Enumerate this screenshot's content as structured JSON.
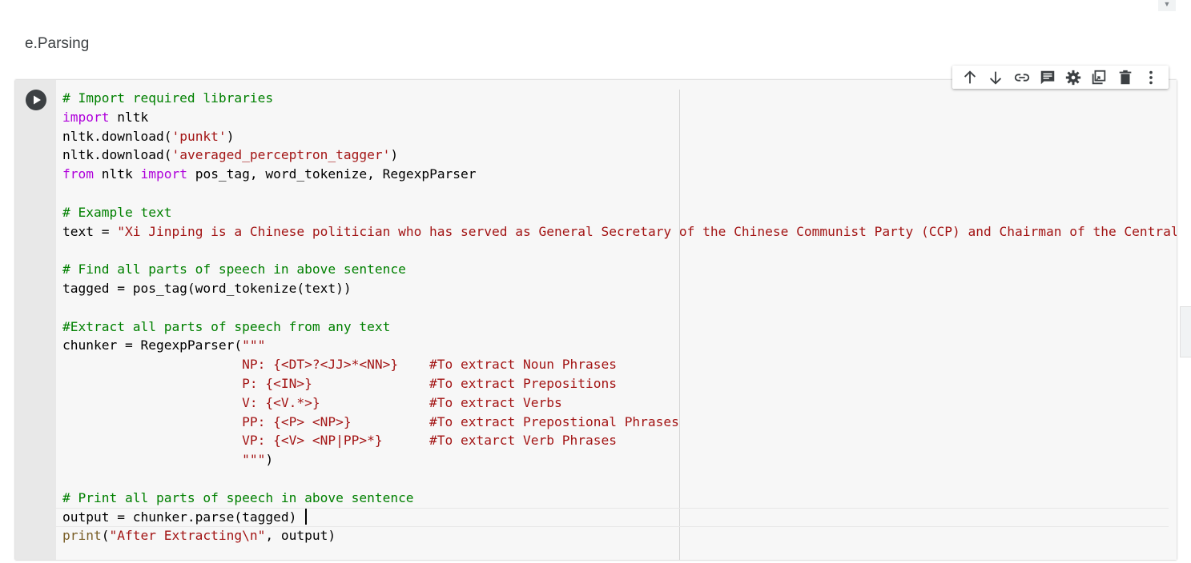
{
  "section": {
    "title": "e.Parsing"
  },
  "cell": {
    "run_icon": "play-circle-icon",
    "code_lines": [
      [
        {
          "t": "com",
          "v": "# Import required libraries"
        }
      ],
      [
        {
          "t": "kw",
          "v": "import"
        },
        {
          "t": "",
          "v": " nltk"
        }
      ],
      [
        {
          "t": "",
          "v": "nltk.download("
        },
        {
          "t": "str",
          "v": "'punkt'"
        },
        {
          "t": "",
          "v": ")"
        }
      ],
      [
        {
          "t": "",
          "v": "nltk.download("
        },
        {
          "t": "str",
          "v": "'averaged_perceptron_tagger'"
        },
        {
          "t": "",
          "v": ")"
        }
      ],
      [
        {
          "t": "kw",
          "v": "from"
        },
        {
          "t": "",
          "v": " nltk "
        },
        {
          "t": "kw",
          "v": "import"
        },
        {
          "t": "",
          "v": " pos_tag, word_tokenize, RegexpParser"
        }
      ],
      [],
      [
        {
          "t": "com",
          "v": "# Example text"
        }
      ],
      [
        {
          "t": "",
          "v": "text = "
        },
        {
          "t": "str",
          "v": "\"Xi Jinping is a Chinese politician who has served as General Secretary of the Chinese Communist Party (CCP) and Chairman of the Central"
        }
      ],
      [],
      [
        {
          "t": "com",
          "v": "# Find all parts of speech in above sentence"
        }
      ],
      [
        {
          "t": "",
          "v": "tagged = pos_tag(word_tokenize(text))"
        }
      ],
      [],
      [
        {
          "t": "com",
          "v": "#Extract all parts of speech from any text"
        }
      ],
      [
        {
          "t": "",
          "v": "chunker = RegexpParser("
        },
        {
          "t": "str",
          "v": "\"\"\""
        }
      ],
      [
        {
          "t": "str",
          "v": "                       NP: {<DT>?<JJ>*<NN>}    #To extract Noun Phrases"
        }
      ],
      [
        {
          "t": "str",
          "v": "                       P: {<IN>}               #To extract Prepositions"
        }
      ],
      [
        {
          "t": "str",
          "v": "                       V: {<V.*>}              #To extract Verbs"
        }
      ],
      [
        {
          "t": "str",
          "v": "                       PP: {<P> <NP>}          #To extract Prepostional Phrases"
        }
      ],
      [
        {
          "t": "str",
          "v": "                       VP: {<V> <NP|PP>*}      #To extarct Verb Phrases"
        }
      ],
      [
        {
          "t": "str",
          "v": "                       \"\"\""
        },
        {
          "t": "",
          "v": ")"
        }
      ],
      [],
      [
        {
          "t": "com",
          "v": "# Print all parts of speech in above sentence"
        }
      ],
      [
        {
          "t": "",
          "v": "output = chunker.parse(tagged) "
        },
        {
          "t": "cursor",
          "v": ""
        }
      ],
      [
        {
          "t": "fn",
          "v": "print"
        },
        {
          "t": "",
          "v": "("
        },
        {
          "t": "str",
          "v": "\"After Extracting\\n\""
        },
        {
          "t": "",
          "v": ", output)"
        }
      ]
    ]
  },
  "toolbar": {
    "buttons": [
      {
        "name": "move-cell-up-button",
        "icon": "arrow-up-icon"
      },
      {
        "name": "move-cell-down-button",
        "icon": "arrow-down-icon"
      },
      {
        "name": "link-to-cell-button",
        "icon": "link-icon"
      },
      {
        "name": "add-comment-button",
        "icon": "comment-icon"
      },
      {
        "name": "cell-settings-button",
        "icon": "gear-icon"
      },
      {
        "name": "mirror-cell-button",
        "icon": "mirror-tab-icon"
      },
      {
        "name": "delete-cell-button",
        "icon": "trash-icon"
      },
      {
        "name": "more-actions-button",
        "icon": "more-vert-icon"
      }
    ]
  },
  "colors": {
    "comment": "#008000",
    "keyword": "#af00db",
    "string": "#a31515",
    "function": "#795e26",
    "cell_background": "#f7f7f7",
    "gutter": "#e8e8e8"
  }
}
